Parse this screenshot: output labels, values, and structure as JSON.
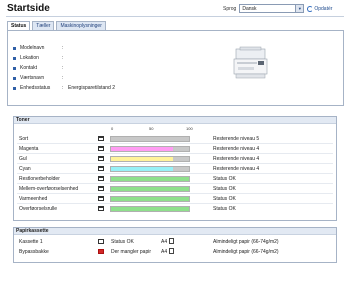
{
  "page": {
    "title": "Startside",
    "language_label": "Sprog",
    "language_value": "Dansk",
    "refresh_label": "Opdatér"
  },
  "tabs": [
    {
      "label": "Status"
    },
    {
      "label": "Tæller"
    },
    {
      "label": "Maskinoplysninger"
    }
  ],
  "info": [
    {
      "label": "Modelnavn",
      "value": ""
    },
    {
      "label": "Lokation",
      "value": ""
    },
    {
      "label": "Kontakt",
      "value": ""
    },
    {
      "label": "Værtsnavn",
      "value": ""
    },
    {
      "label": "Enhedsstatus",
      "value": "Energisparetilstand 2"
    }
  ],
  "toner": {
    "title": "Toner",
    "scale": [
      "0",
      "50",
      "100"
    ],
    "rows": [
      {
        "label": "Sort",
        "level": 0.8,
        "color": "#c8c8c8",
        "status": "Resterende niveau 5"
      },
      {
        "label": "Magenta",
        "level": 0.8,
        "color": "#ff9cf3",
        "status": "Resterende niveau 4"
      },
      {
        "label": "Gul",
        "level": 0.8,
        "color": "#fff39a",
        "status": "Resterende niveau 4"
      },
      {
        "label": "Cyan",
        "level": 0.8,
        "color": "#97f1f6",
        "status": "Resterende niveau 4"
      },
      {
        "label": "Restlonerbeholder",
        "level": 1.0,
        "color": "#8fe08c",
        "status": "Status OK"
      },
      {
        "label": "Mellem-overføorselsenhed",
        "level": 1.0,
        "color": "#8fe08c",
        "status": "Status OK"
      },
      {
        "label": "Varmeenhed",
        "level": 1.0,
        "color": "#8fe08c",
        "status": "Status OK"
      },
      {
        "label": "Overføorselsrulle",
        "level": 1.0,
        "color": "#8fe08c",
        "status": "Status OK"
      }
    ]
  },
  "paper": {
    "title": "Papirkassette",
    "rows": [
      {
        "label": "Kassette 1",
        "status": "Status OK",
        "size": "A4",
        "type": "Almindeligt papir (66-74g/m2)",
        "error": false
      },
      {
        "label": "Bypassbakke",
        "status": "Der mangler papir",
        "size": "A4",
        "type": "Almindeligt papir (66-74g/m2)",
        "error": true
      }
    ]
  }
}
